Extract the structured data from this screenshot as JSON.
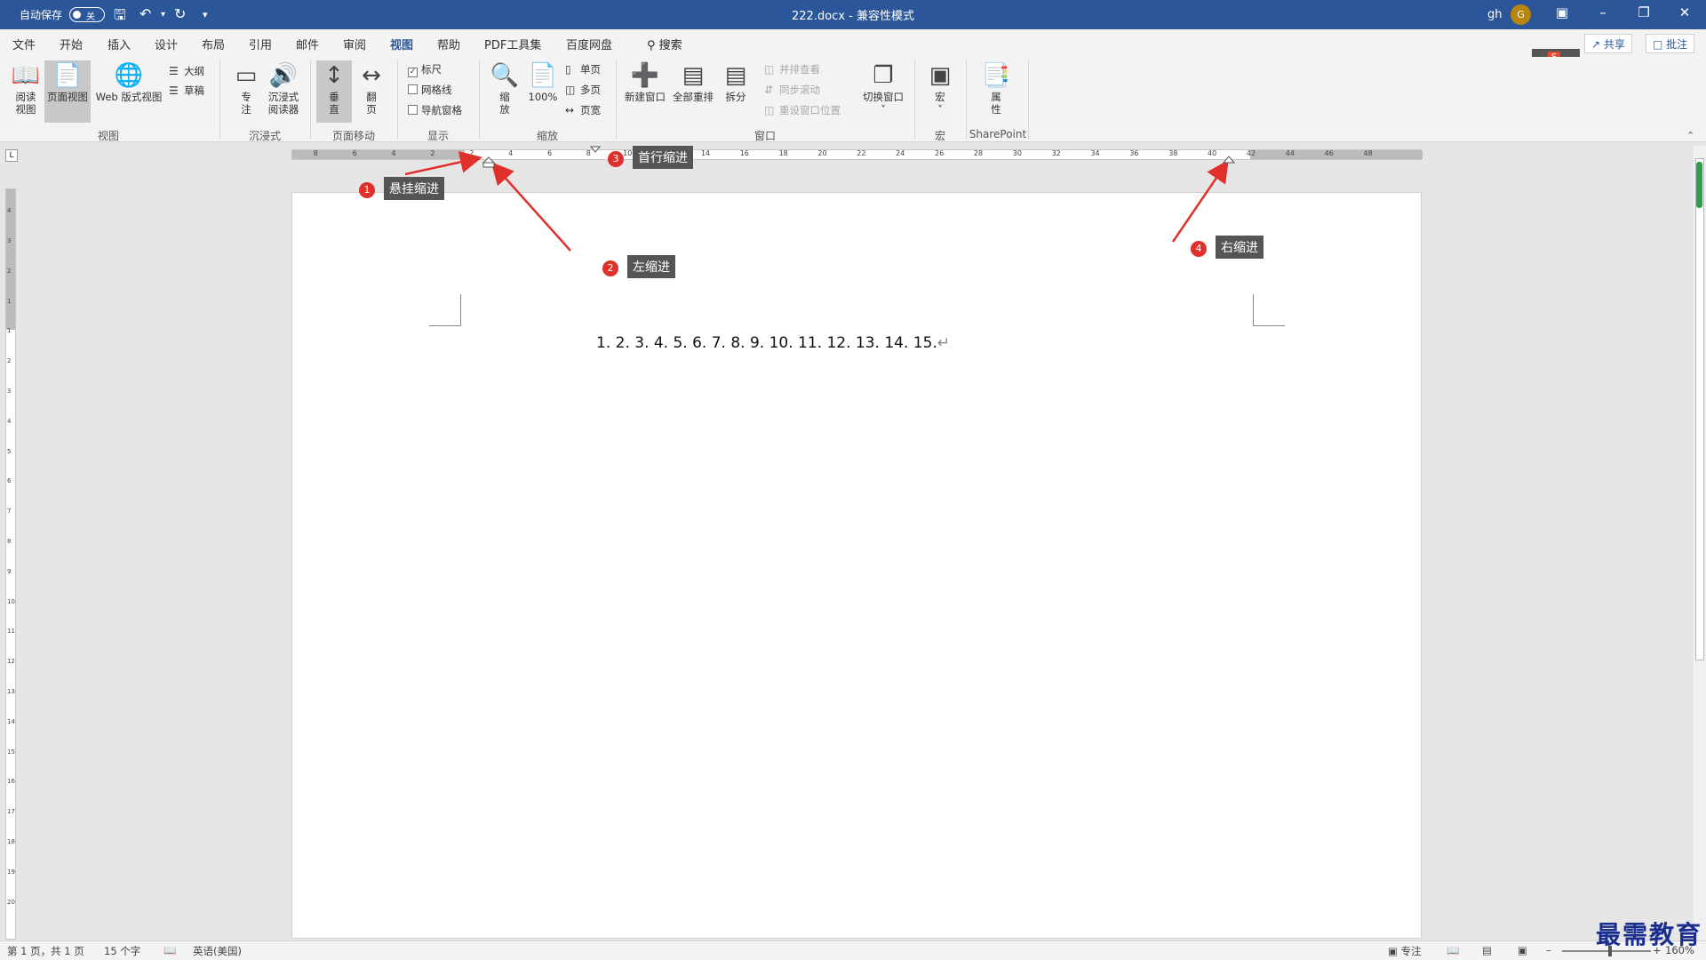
{
  "titlebar": {
    "autosave_label": "自动保存",
    "autosave_state": "关",
    "doc_title": "222.docx - 兼容性模式",
    "user": "gh",
    "avatar_letter": "G"
  },
  "tabs": [
    "文件",
    "开始",
    "插入",
    "设计",
    "布局",
    "引用",
    "邮件",
    "审阅",
    "视图",
    "帮助",
    "PDF工具集",
    "百度网盘"
  ],
  "active_tab": "视图",
  "search_label": "搜索",
  "share_label": "共享",
  "comment_label": "批注",
  "ribbon": {
    "views": {
      "read": "阅读视图",
      "print": "页面视图",
      "web": "Web 版式视图",
      "outline": "大纲",
      "draft": "草稿",
      "group": "视图"
    },
    "immersive": {
      "focus": "专注",
      "reader": "沉浸式阅读器",
      "group": "沉浸式"
    },
    "pagemove": {
      "vertical": "垂直",
      "sidetoside": "翻页",
      "group": "页面移动"
    },
    "show": {
      "ruler": "标尺",
      "gridlines": "网格线",
      "navpane": "导航窗格",
      "group": "显示",
      "ruler_checked": true,
      "gridlines_checked": false,
      "navpane_checked": false
    },
    "zoom": {
      "zoom": "缩放",
      "hundred": "100%",
      "one_page": "单页",
      "multi_page": "多页",
      "page_width": "页宽",
      "group": "缩放"
    },
    "window": {
      "new_window": "新建窗口",
      "arrange_all": "全部重排",
      "split": "拆分",
      "side_by_side": "并排查看",
      "sync_scroll": "同步滚动",
      "reset_pos": "重设窗口位置",
      "switch": "切换窗口",
      "group": "窗口"
    },
    "macros": {
      "macros": "宏",
      "group": "宏"
    },
    "sharepoint": {
      "properties": "属性",
      "group": "SharePoint"
    }
  },
  "ruler_labels": [
    "8",
    "6",
    "4",
    "2",
    "2",
    "4",
    "6",
    "8",
    "10",
    "12",
    "14",
    "16",
    "18",
    "20",
    "22",
    "24",
    "26",
    "28",
    "30",
    "32",
    "34",
    "36",
    "38",
    "40",
    "42",
    "44",
    "46",
    "48"
  ],
  "vruler_labels": [
    "4",
    "3",
    "2",
    "1",
    "1",
    "2",
    "3",
    "4",
    "5",
    "6",
    "7",
    "8",
    "9",
    "10",
    "11",
    "12",
    "13",
    "14",
    "15",
    "16",
    "17",
    "18",
    "19",
    "20"
  ],
  "document_text": "1. 2. 3. 4. 5. 6. 7. 8. 9. 10. 11. 12. 13. 14. 15.",
  "para_mark": "↵",
  "annotations": [
    {
      "num": "1",
      "label": "悬挂缩进"
    },
    {
      "num": "2",
      "label": "左缩进"
    },
    {
      "num": "3",
      "label": "首行缩进"
    },
    {
      "num": "4",
      "label": "右缩进"
    }
  ],
  "status": {
    "page": "第 1 页，共 1 页",
    "words": "15 个字",
    "lang": "英语(美国)",
    "focus": "专注",
    "zoom": "160%"
  },
  "watermark": "最需教育"
}
